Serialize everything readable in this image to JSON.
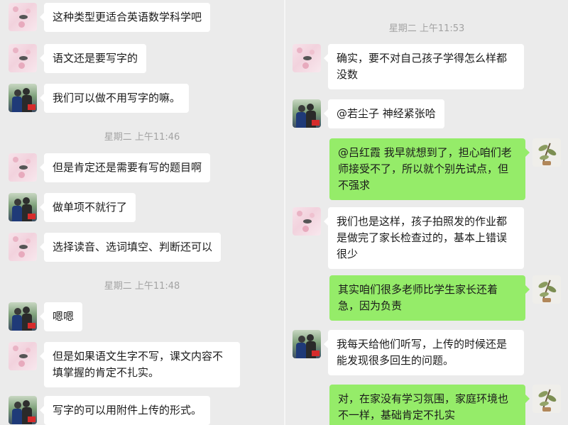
{
  "left_pane": {
    "messages": [
      {
        "text": "这种类型更适合英语数学科学吧",
        "avatar": "blossom-avatar"
      },
      {
        "text": "语文还是要写字的",
        "avatar": "blossom-avatar"
      },
      {
        "text": "我们可以做不用写字的嘛。",
        "avatar": "people-avatar"
      },
      {
        "text": "但是肯定还是需要有写的题目啊",
        "avatar": "blossom-avatar"
      },
      {
        "text": "做单项不就行了",
        "avatar": "people-avatar"
      },
      {
        "text": "选择读音、选词填空、判断还可以",
        "avatar": "blossom-avatar"
      },
      {
        "text": "嗯嗯",
        "avatar": "people-avatar"
      },
      {
        "text": "但是如果语文生字不写，课文内容不填掌握的肯定不扎实。",
        "avatar": "blossom-avatar"
      },
      {
        "text": "写字的可以用附件上传的形式。",
        "avatar": "people-avatar"
      }
    ],
    "timestamps": [
      "星期二 上午11:46",
      "星期二 上午11:48"
    ]
  },
  "right_pane": {
    "timestamps": [
      "星期二 上午11:53"
    ],
    "messages": [
      {
        "text": "确实，要不对自己孩子学得怎么样都没数",
        "avatar": "blossom-avatar",
        "side": "incoming"
      },
      {
        "text": "@若尘子 神经紧张哈",
        "avatar": "people-avatar",
        "side": "incoming"
      },
      {
        "text": "@吕红霞 我早就想到了，担心咱们老师接受不了，所以就个别先试点，但不强求",
        "avatar": "plant-avatar",
        "side": "outgoing"
      },
      {
        "text": "我们也是这样，孩子拍照发的作业都是做完了家长检查过的，基本上错误很少",
        "avatar": "blossom-avatar",
        "side": "incoming"
      },
      {
        "text": "其实咱们很多老师比学生家长还着急，因为负责",
        "avatar": "plant-avatar",
        "side": "outgoing"
      },
      {
        "text": "我每天给他们听写，上传的时候还是能发现很多回生的问题。",
        "avatar": "people-avatar",
        "side": "incoming"
      },
      {
        "text": "对，在家没有学习氛围，家庭环境也不一样，基础肯定不扎实",
        "avatar": "plant-avatar",
        "side": "outgoing"
      }
    ]
  },
  "colors": {
    "background": "#ebebeb",
    "incoming_bubble": "#ffffff",
    "outgoing_bubble": "#95ec69",
    "timestamp": "#a3a3a3"
  }
}
